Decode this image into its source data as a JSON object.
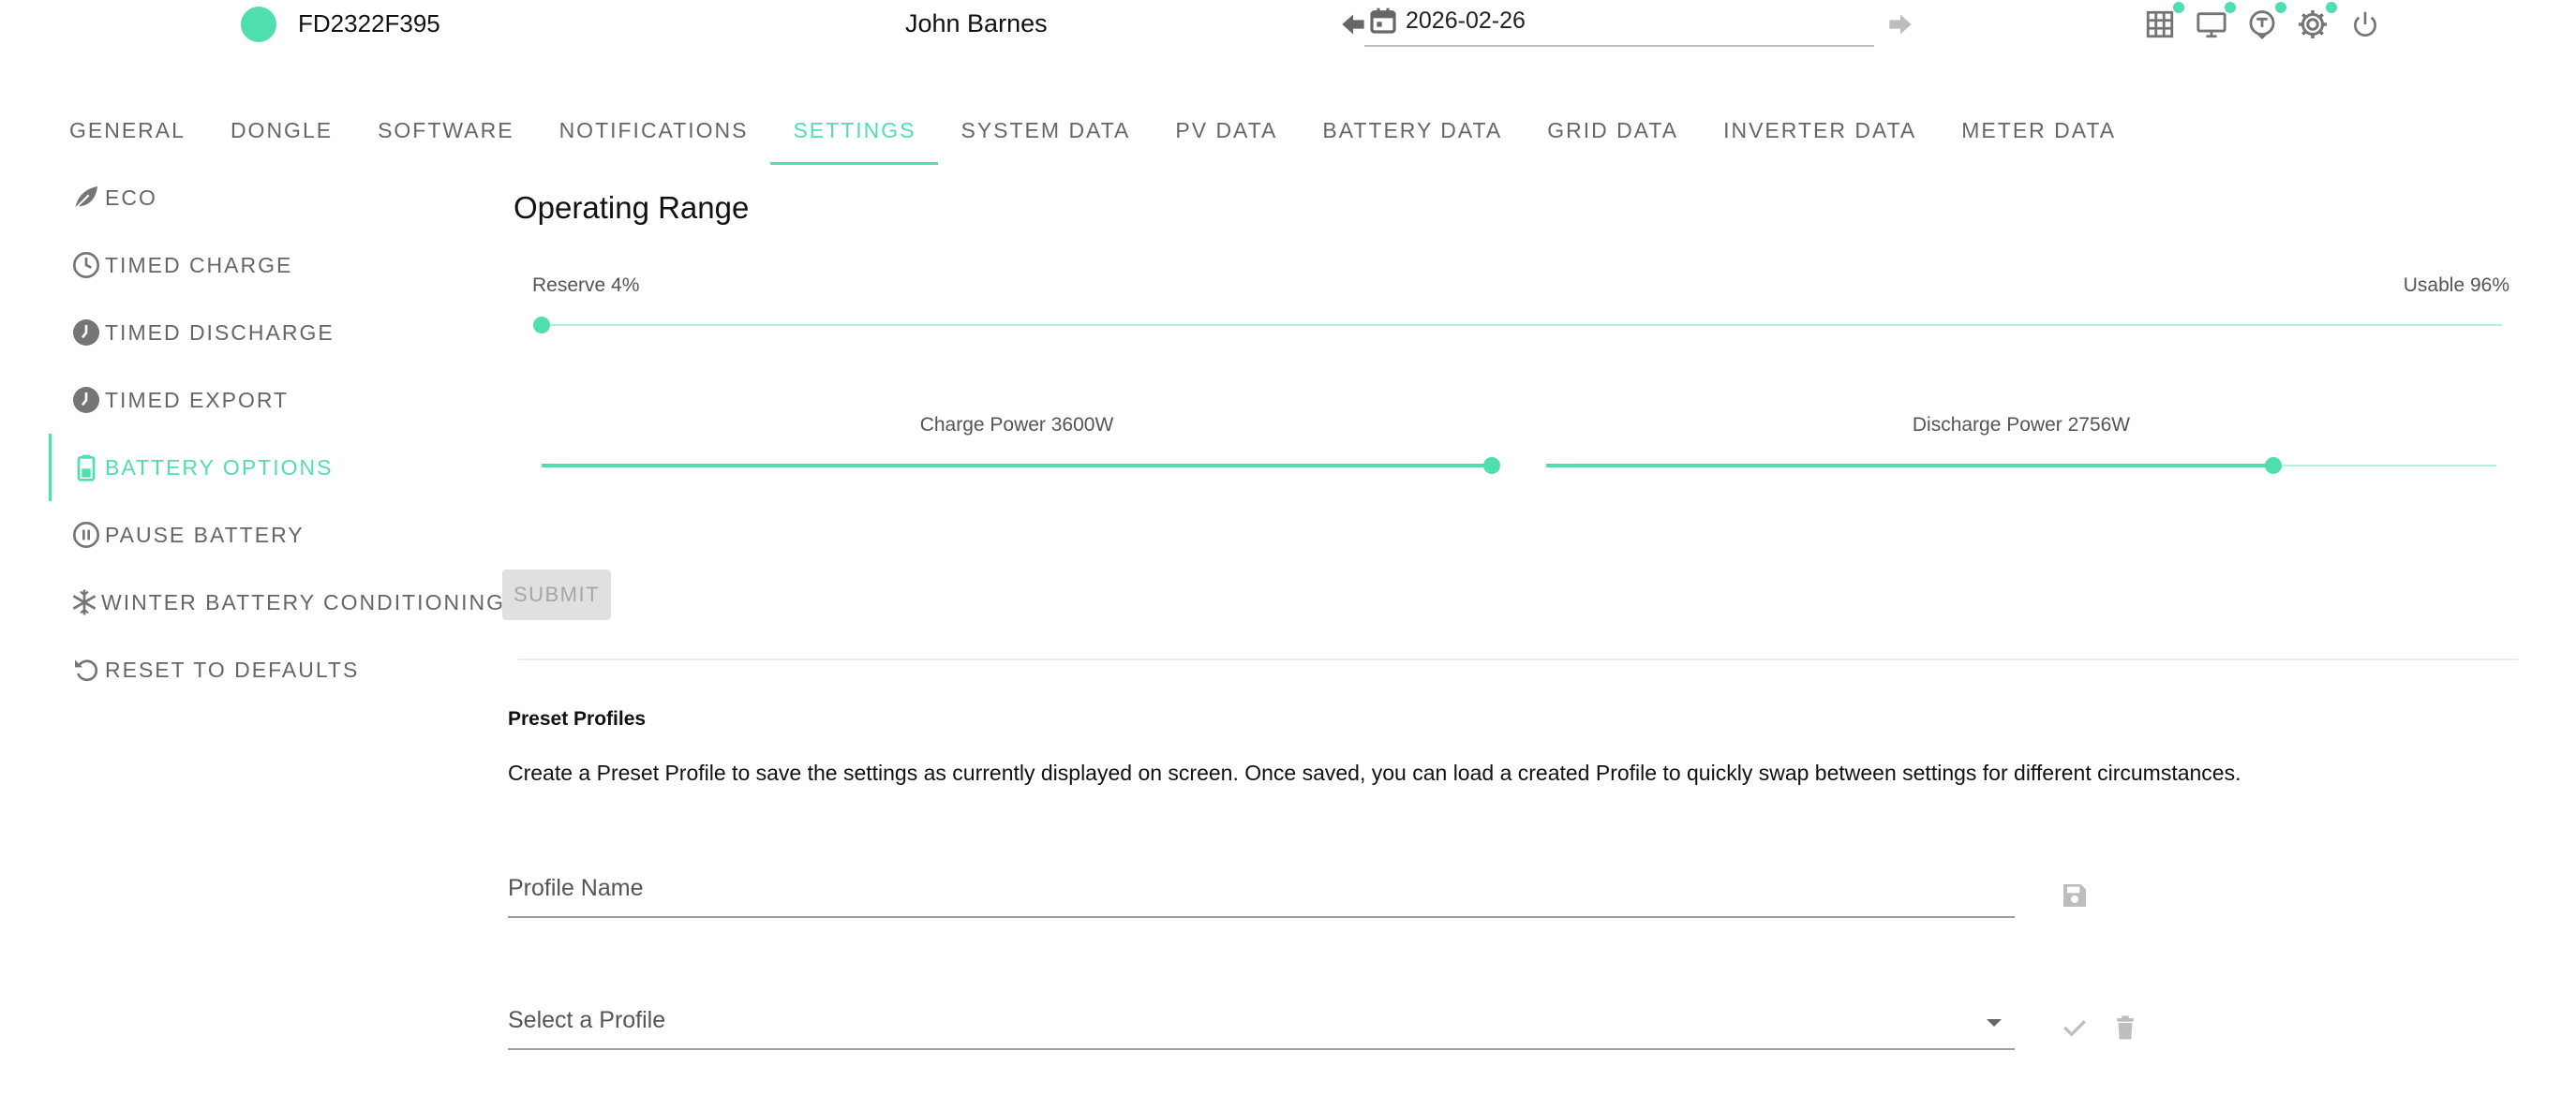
{
  "header": {
    "device_id": "FD2322F395",
    "user_name": "John Barnes",
    "date": "2026-02-26",
    "status_color": "#4fdfaf",
    "icons": [
      "grid-icon",
      "monitor-icon",
      "tag-icon",
      "settings-icon",
      "power-icon"
    ]
  },
  "tabs": [
    {
      "label": "GENERAL"
    },
    {
      "label": "DONGLE"
    },
    {
      "label": "SOFTWARE"
    },
    {
      "label": "NOTIFICATIONS"
    },
    {
      "label": "SETTINGS",
      "active": true
    },
    {
      "label": "SYSTEM DATA"
    },
    {
      "label": "PV DATA"
    },
    {
      "label": "BATTERY DATA"
    },
    {
      "label": "GRID DATA"
    },
    {
      "label": "INVERTER DATA"
    },
    {
      "label": "METER DATA"
    }
  ],
  "sidebar": {
    "items": [
      {
        "label": "ECO",
        "icon": "leaf-icon"
      },
      {
        "label": "TIMED CHARGE",
        "icon": "clock-icon"
      },
      {
        "label": "TIMED DISCHARGE",
        "icon": "clock-filled-icon"
      },
      {
        "label": "TIMED EXPORT",
        "icon": "clock-filled-icon"
      },
      {
        "label": "BATTERY OPTIONS",
        "icon": "battery-icon",
        "active": true
      },
      {
        "label": "PAUSE BATTERY",
        "icon": "pause-icon"
      },
      {
        "label": "WINTER BATTERY CONDITIONING",
        "icon": "snowflake-icon"
      },
      {
        "label": "RESET TO DEFAULTS",
        "icon": "reset-icon"
      }
    ]
  },
  "operating_range": {
    "title": "Operating Range",
    "reserve_label": "Reserve 4%",
    "usable_label": "Usable 96%",
    "reserve_percent": 4
  },
  "power": {
    "charge_label": "Charge Power 3600W",
    "charge_fraction": 1.0,
    "discharge_label": "Discharge Power 2756W",
    "discharge_fraction": 0.7656
  },
  "submit_label": "SUBMIT",
  "preset": {
    "title": "Preset Profiles",
    "description": "Create a Preset Profile to save the settings as currently displayed on screen. Once saved, you can load a created Profile to quickly swap between settings for different circumstances.",
    "name_placeholder": "Profile Name",
    "select_placeholder": "Select a Profile"
  },
  "colors": {
    "accent": "#4fdfaf",
    "icon": "#757575"
  }
}
